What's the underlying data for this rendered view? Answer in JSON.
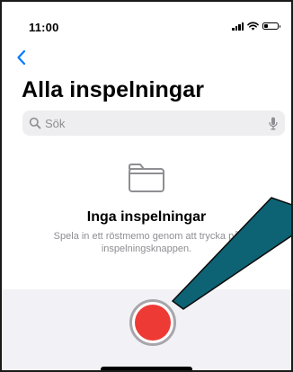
{
  "status_bar": {
    "time": "11:00",
    "battery_level": 0.3
  },
  "nav": {
    "back_icon": "chevron-left-icon",
    "title": "Alla inspelningar"
  },
  "search": {
    "placeholder": "Sök",
    "value": "",
    "icon": "magnifier-icon",
    "mic_icon": "microphone-icon"
  },
  "empty_state": {
    "icon": "folder-icon",
    "title": "Inga inspelningar",
    "text": "Spela in ett röstmemo genom att trycka på inspelningsknappen."
  },
  "record": {
    "icon": "record-icon"
  },
  "colors": {
    "accent": "#007aff",
    "record_red": "#ee3a34",
    "callout_fill": "#0d6374",
    "panel_background": "#f2f1f6"
  }
}
